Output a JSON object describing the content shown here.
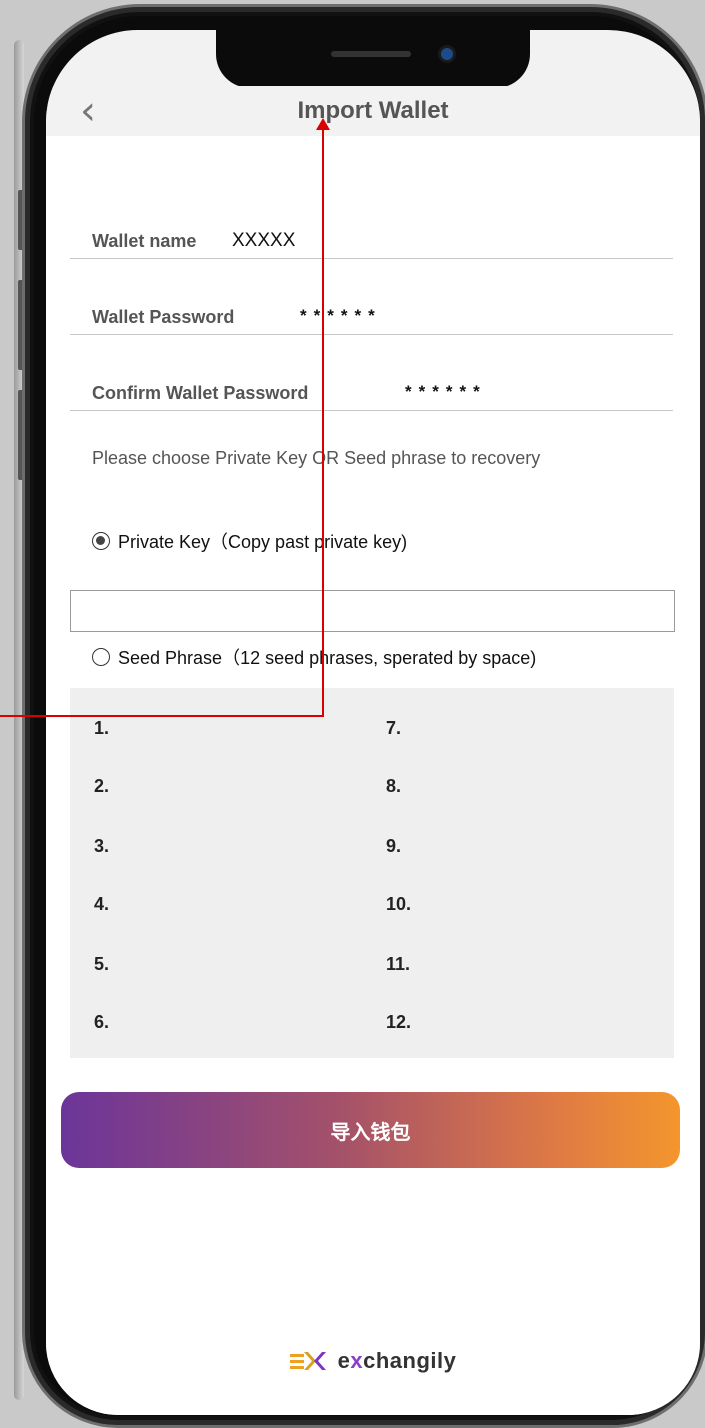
{
  "header": {
    "back_icon": "‹",
    "title": "Import Wallet"
  },
  "form": {
    "wallet_name": {
      "label": "Wallet name",
      "value": "XXXXX"
    },
    "wallet_password": {
      "label": "Wallet Password",
      "value": "******"
    },
    "confirm_password": {
      "label": "Confirm Wallet Password",
      "value": "******"
    }
  },
  "recovery": {
    "hint": "Please choose Private Key OR Seed phrase to recovery",
    "private_key_option": {
      "label": "Private Key（Copy past private key)",
      "selected": true
    },
    "private_key_input": {
      "value": "",
      "placeholder": ""
    },
    "seed_phrase_option": {
      "label": "Seed Phrase（12 seed phrases, sperated by space)",
      "selected": false
    },
    "seed_items": [
      "1.",
      "2.",
      "3.",
      "4.",
      "5.",
      "6.",
      "7.",
      "8.",
      "9.",
      "10.",
      "11.",
      "12."
    ]
  },
  "import_button": {
    "label": "导入钱包"
  },
  "logo": {
    "text_prefix": "e",
    "text_x": "x",
    "text_rest": "changily"
  },
  "colors": {
    "button_gradient_start": "#6b3599",
    "button_gradient_end": "#f4962d",
    "annotation": "#d80000"
  }
}
